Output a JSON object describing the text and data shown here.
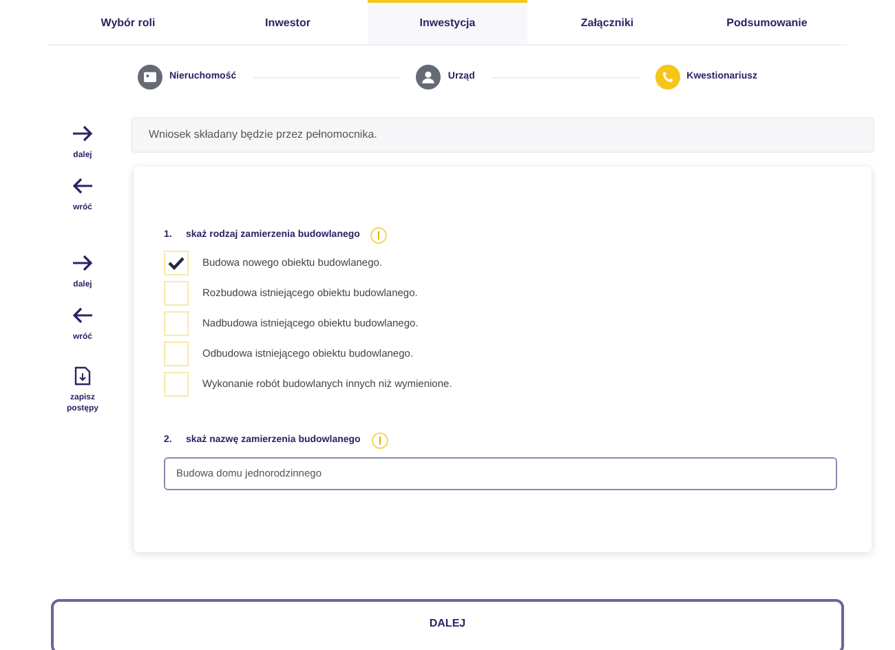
{
  "tabs": [
    {
      "label": "Wybór roli",
      "selected": false
    },
    {
      "label": "Inwestor",
      "selected": false
    },
    {
      "label": "Inwestycja",
      "selected": true
    },
    {
      "label": "Załączniki",
      "selected": false
    },
    {
      "label": "Podsumowanie",
      "selected": false
    }
  ],
  "steps": [
    {
      "label": "Nieruchomość",
      "selected": false,
      "kind": "building"
    },
    {
      "label": "Urząd",
      "selected": false,
      "kind": "person"
    },
    {
      "label": "Kwestionariusz",
      "selected": true,
      "kind": "phone"
    }
  ],
  "sidebar": [
    {
      "kind": "next",
      "label": "dalej"
    },
    {
      "kind": "back",
      "label": "wróć"
    },
    {
      "kind": "next",
      "label": "dalej"
    },
    {
      "kind": "back",
      "label": "wróć"
    },
    {
      "kind": "save",
      "label": "zapisz postępy"
    }
  ],
  "notice": "Wniosek składany będzie przez pełnomocnika.",
  "questions": [
    {
      "kind": "checklist",
      "number": "1.",
      "title": "skaż rodzaj zamierzenia budowlanego",
      "options": [
        {
          "label": "Budowa nowego obiektu budowlanego.",
          "checked": true
        },
        {
          "label": "Rozbudowa istniejącego obiektu budowlanego.",
          "checked": false
        },
        {
          "label": "Nadbudowa istniejącego obiektu budowlanego.",
          "checked": false
        },
        {
          "label": "Odbudowa istniejącego obiektu budowlanego.",
          "checked": false
        },
        {
          "label": "Wykonanie robót budowlanych innych niż wymienione.",
          "checked": false
        }
      ]
    },
    {
      "kind": "text",
      "number": "2.",
      "title": "skaż nazwę zamierzenia budowlanego",
      "value": "Budowa domu jednorodzinnego"
    }
  ],
  "next_button": "DALEJ"
}
